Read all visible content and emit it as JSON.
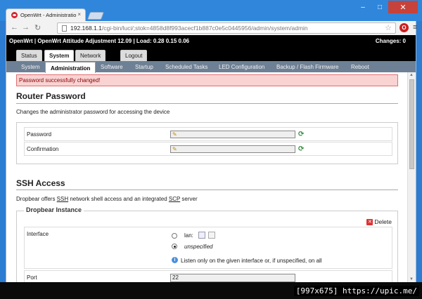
{
  "browser": {
    "tab_title": "OpenWrt - Administratio",
    "tab_close": "×",
    "url_host": "192.168.1.1",
    "url_rest": "/cgi-bin/luci/;stok=4858d8f993acecf1b887c0e5c0445956/admin/system/admin",
    "window_controls": [
      "–",
      "□",
      "✕"
    ],
    "extension_icon": "O"
  },
  "luci": {
    "header": "OpenWrt | OpenWrt Attitude Adjustment 12.09 | Load: 0.28 0.15 0.06",
    "changes": "Changes: 0",
    "main_tabs": [
      "Status",
      "System",
      "Network",
      "Logout"
    ],
    "active_main_tab": "System",
    "sub_tabs": [
      "System",
      "Administration",
      "Software",
      "Startup",
      "Scheduled Tasks",
      "LED Configuration",
      "Backup / Flash Firmware",
      "Reboot"
    ],
    "active_sub_tab": "Administration"
  },
  "alert": "Password successfully changed!",
  "router_password": {
    "title": "Router Password",
    "description": "Changes the administrator password for accessing the device",
    "fields": [
      {
        "label": "Password",
        "value": ""
      },
      {
        "label": "Confirmation",
        "value": ""
      }
    ]
  },
  "ssh": {
    "title": "SSH Access",
    "description_pre": "Dropbear offers ",
    "description_ssh": "SSH",
    "description_mid": " network shell access and an integrated ",
    "description_scp": "SCP",
    "description_post": " server",
    "instance_legend": "Dropbear Instance",
    "delete_label": "Delete",
    "interface_label": "Interface",
    "interface_options": [
      "lan:",
      "unspecified"
    ],
    "interface_selected": "unspecified",
    "interface_hint": "Listen only on the given interface or, if unspecified, on all",
    "port_label": "Port",
    "port_value": "22"
  },
  "watermark": "[997x675] https://upic.me/"
}
